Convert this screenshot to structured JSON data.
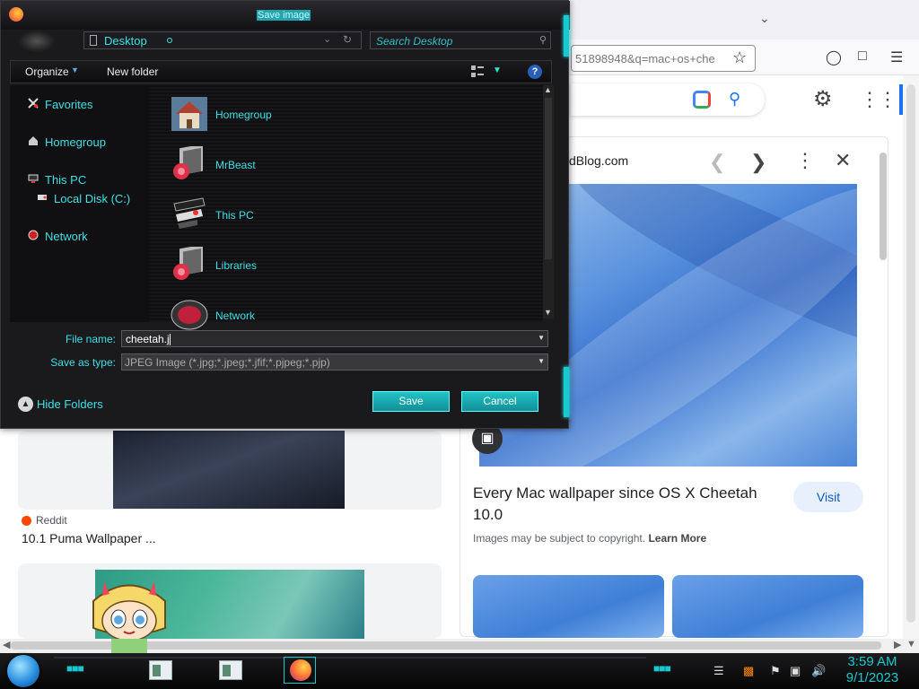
{
  "dialog": {
    "title": "Save image",
    "address": "Desktop",
    "search_placeholder": "Search Desktop",
    "toolbar": {
      "organize": "Organize",
      "new_folder": "New folder"
    },
    "nav": {
      "favorites": "Favorites",
      "homegroup": "Homegroup",
      "this_pc": "This PC",
      "local_disk": "Local Disk (C:)",
      "network": "Network"
    },
    "items": [
      "Homegroup",
      "MrBeast",
      "This PC",
      "Libraries",
      "Network"
    ],
    "file_name_label": "File name:",
    "file_name_value": "cheetah.j",
    "save_as_type_label": "Save as type:",
    "save_as_type_value": "JPEG Image (*.jpg;*.jpeg;*.jfif;*.pjpeg;*.pjp)",
    "hide_folders": "Hide Folders",
    "save_button": "Save",
    "cancel_button": "Cancel"
  },
  "browser": {
    "url_fragment": "51898948&q=mac+os+che",
    "preview_site": "dBlog.com",
    "preview_title": "Every Mac wallpaper since OS X Cheetah 10.0",
    "visit_button": "Visit",
    "copyright_text": "Images may be subject to copyright.",
    "learn_more": "Learn More",
    "result_source": "Reddit",
    "result_title": "10.1 Puma Wallpaper ..."
  },
  "taskbar": {
    "time": "3:59 AM",
    "date": "9/1/2023"
  },
  "colors": {
    "accent_cyan": "#18c9cf",
    "dialog_text_cyan": "#3fe0e6",
    "dialog_bg": "#1a1a1c",
    "google_blue": "#1a73e8"
  },
  "icons": {
    "titlebar": "firefox-icon",
    "toolbar_view": "view-options-icon",
    "help": "help-icon",
    "star": "bookmark-star-icon",
    "lens": "google-lens-icon",
    "search": "search-icon",
    "settings": "gear-icon",
    "apps": "apps-grid-icon"
  }
}
